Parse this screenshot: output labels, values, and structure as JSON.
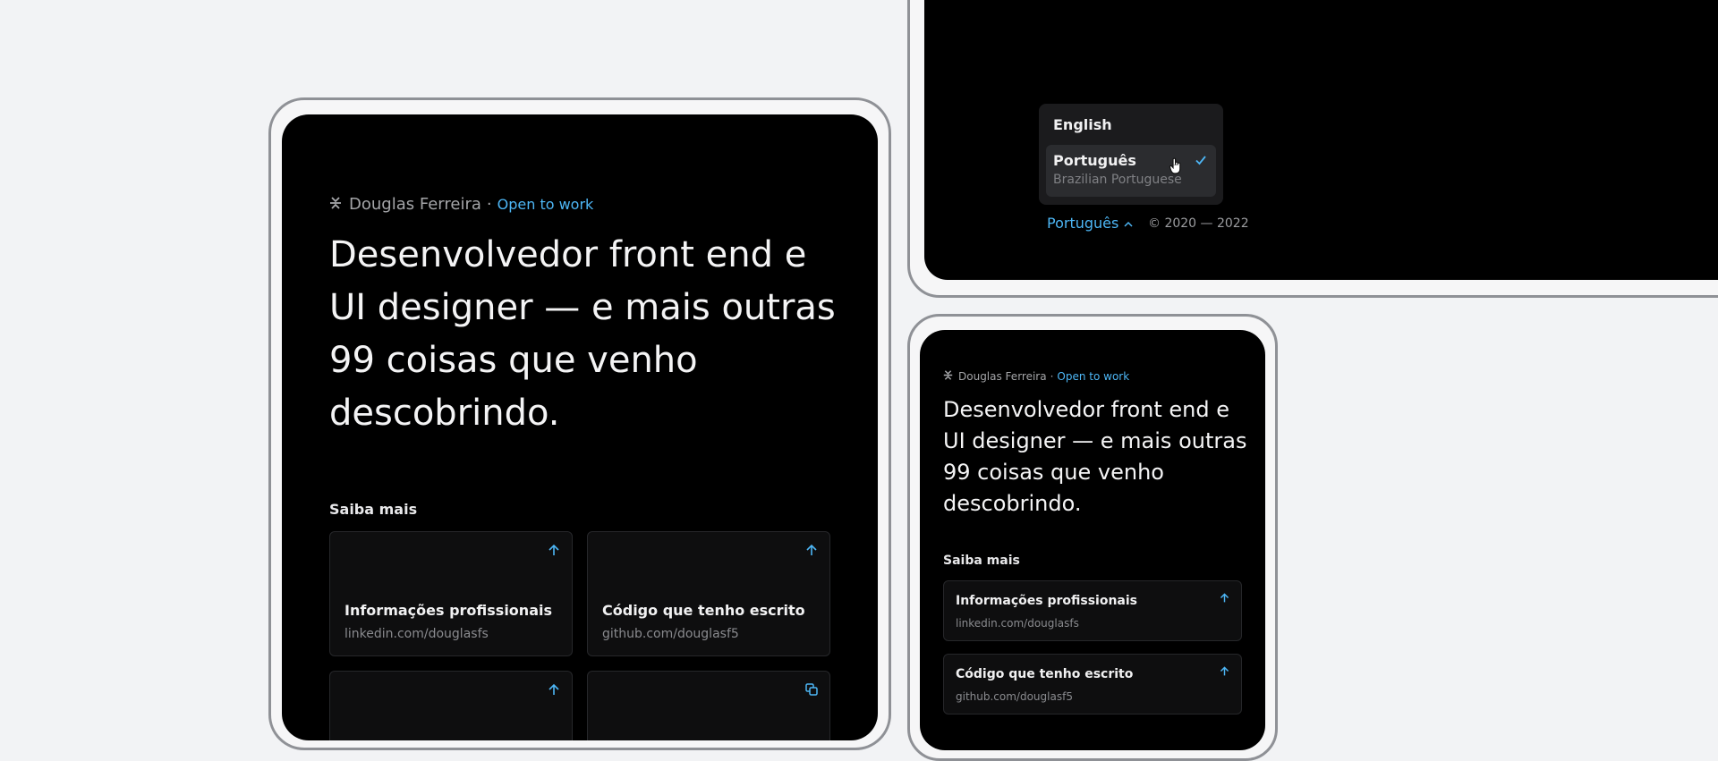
{
  "profile": {
    "name": "Douglas Ferreira",
    "separator": "·",
    "status": "Open to work",
    "headline": "Desenvolvedor front end e UI designer — e mais outras 99 coisas que venho descobrindo.",
    "section_label": "Saiba mais"
  },
  "links": [
    {
      "title": "Informações profissionais",
      "url": "linkedin.com/douglasfs",
      "icon": "arrow-up-icon"
    },
    {
      "title": "Código que tenho escrito",
      "url": "github.com/douglasf5",
      "icon": "arrow-up-icon"
    },
    {
      "title": "",
      "url": "",
      "icon": "arrow-up-icon"
    },
    {
      "title": "",
      "url": "",
      "icon": "copy-icon"
    }
  ],
  "language_menu": {
    "options": [
      {
        "label": "English"
      },
      {
        "label": "Português",
        "sublabel": "Brazilian Portuguese",
        "selected": true
      }
    ],
    "current": "Português",
    "copyright": "© 2020 — 2022"
  },
  "colors": {
    "accent": "#4db6f5",
    "background": "#f2f3f5",
    "screen": "#000000",
    "card": "#0e0e0f"
  }
}
